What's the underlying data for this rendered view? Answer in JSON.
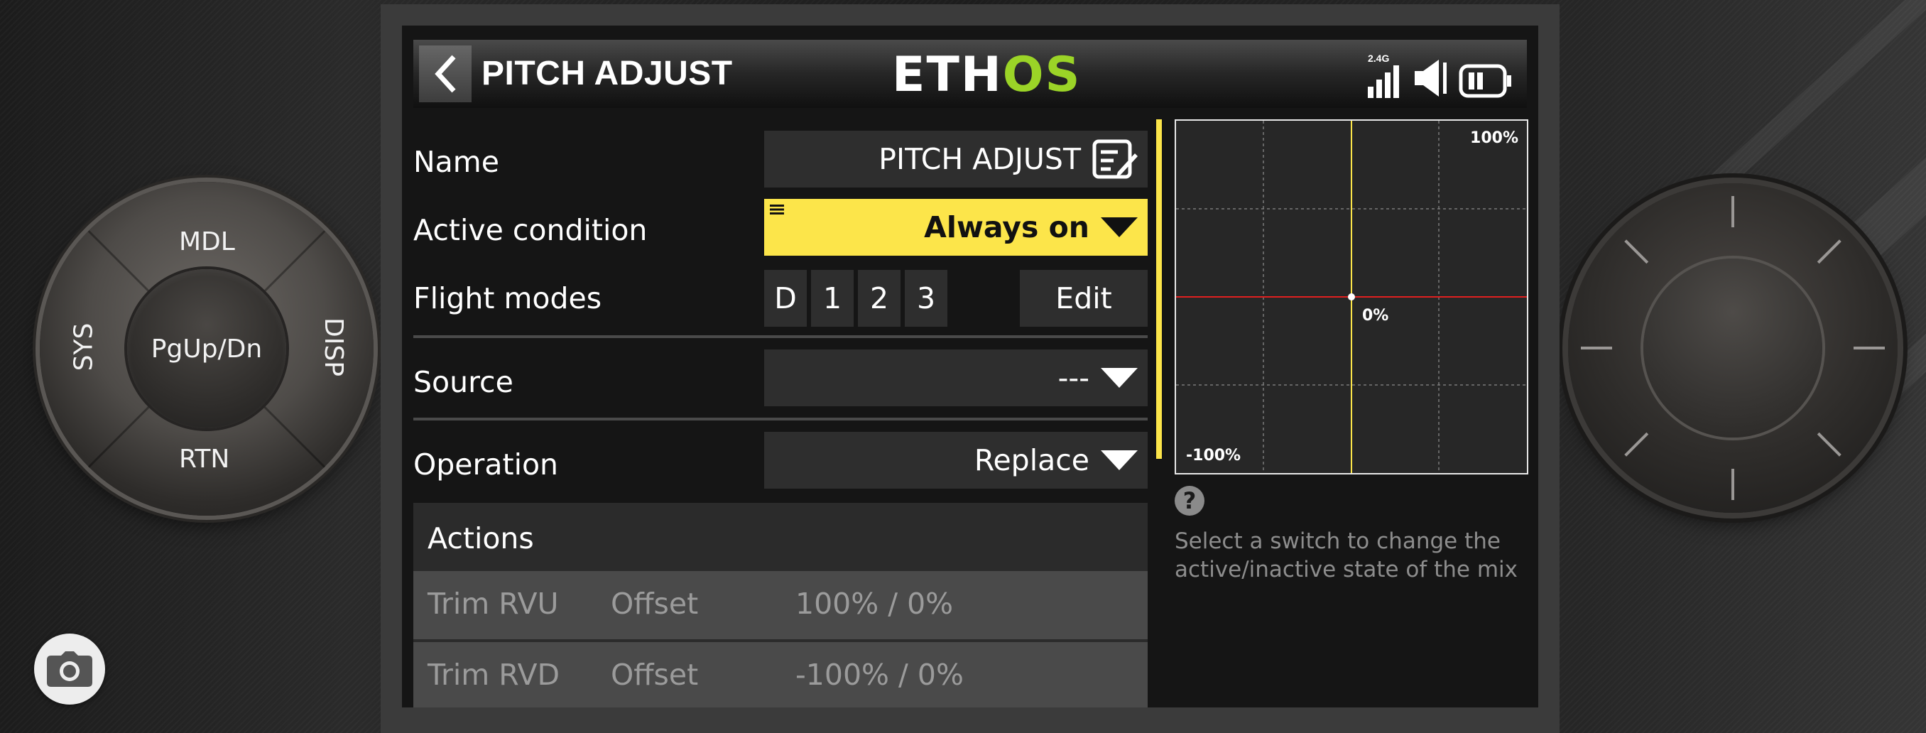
{
  "hardware": {
    "left_ring": {
      "top": "MDL",
      "bottom": "RTN",
      "left": "SYS",
      "right": "DISP",
      "center": "PgUp/Dn"
    }
  },
  "header": {
    "title": "PITCH ADJUST",
    "brand_part1": "ETH",
    "brand_part2": "OS",
    "signal_band": "2.4G"
  },
  "form": {
    "name": {
      "label": "Name",
      "value": "PITCH ADJUST"
    },
    "active_condition": {
      "label": "Active condition",
      "value": "Always on"
    },
    "flight_modes": {
      "label": "Flight modes",
      "modes": [
        "D",
        "1",
        "2",
        "3"
      ],
      "edit_label": "Edit"
    },
    "source": {
      "label": "Source",
      "value": "---"
    },
    "operation": {
      "label": "Operation",
      "value": "Replace"
    }
  },
  "actions": {
    "title": "Actions",
    "rows": [
      {
        "name": "Trim RVU",
        "type": "Offset",
        "value": "100% / 0%"
      },
      {
        "name": "Trim RVD",
        "type": "Offset",
        "value": "-100% / 0%"
      }
    ]
  },
  "graph": {
    "top_label": "100%",
    "center_label": "0%",
    "bottom_label": "-100%"
  },
  "help": {
    "icon": "?",
    "text": "Select a switch to change the active/inactive state of the mix"
  },
  "colors": {
    "accent_yellow": "#fce54a",
    "brand_green": "#9bd427",
    "curve_red": "#e02020"
  }
}
